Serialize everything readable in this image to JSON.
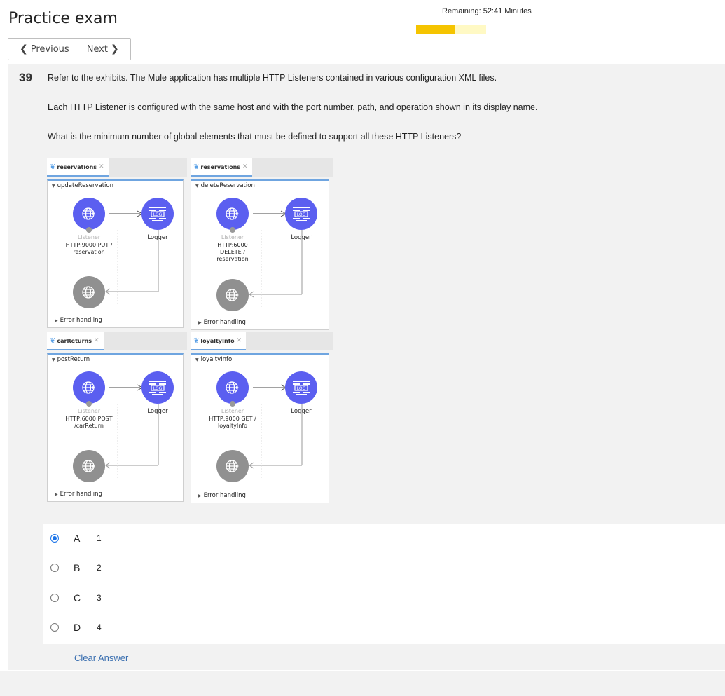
{
  "header": {
    "title": "Practice exam",
    "remaining": "Remaining: 52:41 Minutes",
    "progress_fraction": 0.55,
    "prev_label": "Previous",
    "next_label": "Next"
  },
  "question": {
    "number": "39",
    "paragraphs": [
      "Refer to the exhibits. The Mule application has multiple HTTP Listeners contained in various configuration XML files.",
      "Each HTTP Listener is configured with the same host and with the port number, path, and operation shown in its display name.",
      "What is the minimum number of global elements that must be defined to support all these HTTP Listeners?"
    ]
  },
  "exhibits": [
    {
      "tab": "reservations",
      "flow": "updateReservation",
      "listener_title": "Listener",
      "listener_lines": [
        "HTTP:9000 PUT /",
        "reservation"
      ],
      "logger": "Logger",
      "error": "Error handling"
    },
    {
      "tab": "reservations",
      "flow": "deleteReservation",
      "listener_title": "Listener",
      "listener_lines": [
        "HTTP:6000",
        "DELETE /",
        "reservation"
      ],
      "logger": "Logger",
      "error": "Error handling"
    },
    {
      "tab": "carReturns",
      "flow": "postReturn",
      "listener_title": "Listener",
      "listener_lines": [
        "HTTP:6000 POST",
        "/carReturn"
      ],
      "logger": "Logger",
      "error": "Error handling"
    },
    {
      "tab": "loyaltyInfo",
      "flow": "loyaltyInfo",
      "listener_title": "Listener",
      "listener_lines": [
        "HTTP:9000 GET /",
        "loyaltyInfo"
      ],
      "logger": "Logger",
      "error": "Error handling"
    }
  ],
  "icons": {
    "listener": "globe-icon",
    "logger": "log-icon",
    "tab": "mule-icon",
    "close": "close-icon"
  },
  "answers": [
    {
      "letter": "A",
      "text": "1",
      "selected": true
    },
    {
      "letter": "B",
      "text": "2",
      "selected": false
    },
    {
      "letter": "C",
      "text": "3",
      "selected": false
    },
    {
      "letter": "D",
      "text": "4",
      "selected": false
    }
  ],
  "clear_label": "Clear Answer",
  "colors": {
    "accent": "#1a73e8",
    "progress": "#f5c400",
    "progress_track": "#fff9c4",
    "component": "#5b5ff0",
    "tab_underline": "#6fa5e0"
  }
}
